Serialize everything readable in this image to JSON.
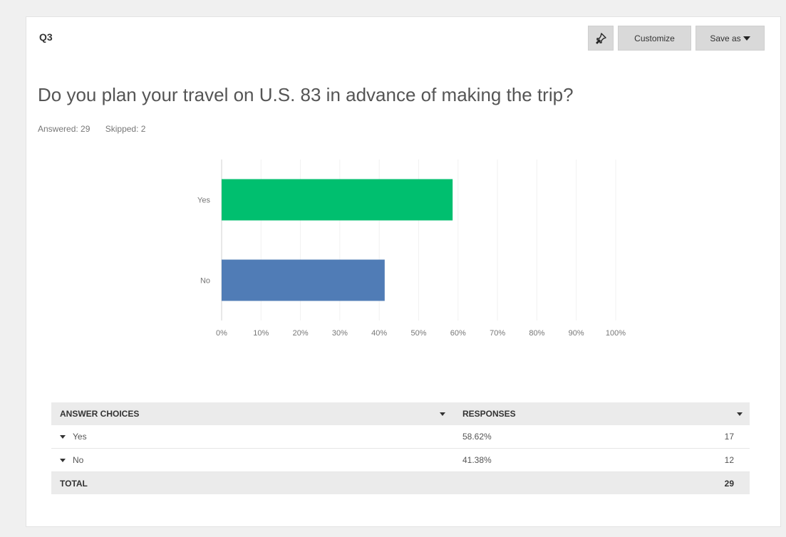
{
  "header": {
    "question_number": "Q3",
    "customize_label": "Customize",
    "save_as_label": "Save as"
  },
  "question": {
    "title": "Do you plan your travel on U.S. 83 in advance of making the trip?",
    "answered": "Answered: 29",
    "skipped": "Skipped: 2"
  },
  "chart_data": {
    "type": "bar",
    "orientation": "horizontal",
    "categories": [
      "Yes",
      "No"
    ],
    "values": [
      58.62,
      41.38
    ],
    "colors": [
      "#00bf6f",
      "#507cb6"
    ],
    "xlim": [
      0,
      100
    ],
    "x_ticks": [
      "0%",
      "10%",
      "20%",
      "30%",
      "40%",
      "50%",
      "60%",
      "70%",
      "80%",
      "90%",
      "100%"
    ],
    "grid": true
  },
  "table": {
    "headers": {
      "choices": "ANSWER CHOICES",
      "responses": "RESPONSES"
    },
    "rows": [
      {
        "choice": "Yes",
        "percent": "58.62%",
        "count": "17"
      },
      {
        "choice": "No",
        "percent": "41.38%",
        "count": "12"
      }
    ],
    "total_label": "TOTAL",
    "total_value": "29"
  },
  "icons": {
    "pin": "pin-icon",
    "dropdown": "chevron-down-icon"
  }
}
